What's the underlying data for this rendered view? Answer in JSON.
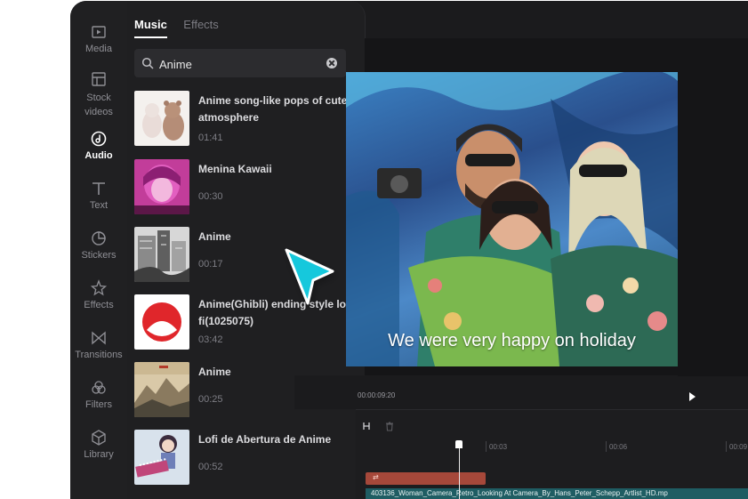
{
  "rail": {
    "items": [
      {
        "label": "Media",
        "icon": "media-icon"
      },
      {
        "label": "Stock videos",
        "icon": "stock-videos-icon"
      },
      {
        "label": "Audio",
        "icon": "audio-icon",
        "active": true
      },
      {
        "label": "Text",
        "icon": "text-icon"
      },
      {
        "label": "Stickers",
        "icon": "stickers-icon"
      },
      {
        "label": "Effects",
        "icon": "effects-icon"
      },
      {
        "label": "Transitions",
        "icon": "transitions-icon"
      },
      {
        "label": "Filters",
        "icon": "filters-icon"
      },
      {
        "label": "Library",
        "icon": "library-icon"
      }
    ]
  },
  "panel": {
    "tabs": [
      {
        "label": "Music",
        "active": true
      },
      {
        "label": "Effects",
        "active": false
      }
    ],
    "search": {
      "value": "Anime"
    },
    "tracks": [
      {
        "title": "Anime song-like pops of cute atmosphere",
        "duration": "01:41"
      },
      {
        "title": "Menina Kawaii",
        "duration": "00:30"
      },
      {
        "title": "Anime",
        "duration": "00:17"
      },
      {
        "title": "Anime(Ghibli) ending style lo-fi(1025075)",
        "duration": "03:42"
      },
      {
        "title": "Anime",
        "duration": "00:25"
      },
      {
        "title": "Lofi de Abertura de Anime",
        "duration": "00:52"
      }
    ]
  },
  "preview": {
    "subtitle": "We were very happy on holiday",
    "timecode": "00:00:09:20"
  },
  "timeline": {
    "ticks": [
      "00:03",
      "00:06",
      "00:09"
    ],
    "audio_clip_label": "⇄",
    "video_clip_label": "403136_Woman_Camera_Retro_Looking At Camera_By_Hans_Peter_Schepp_Artlist_HD.mp"
  },
  "colors": {
    "accent_cursor": "#14c8dc",
    "audio_clip": "#a6483a",
    "video_clip": "#1f5d63"
  }
}
